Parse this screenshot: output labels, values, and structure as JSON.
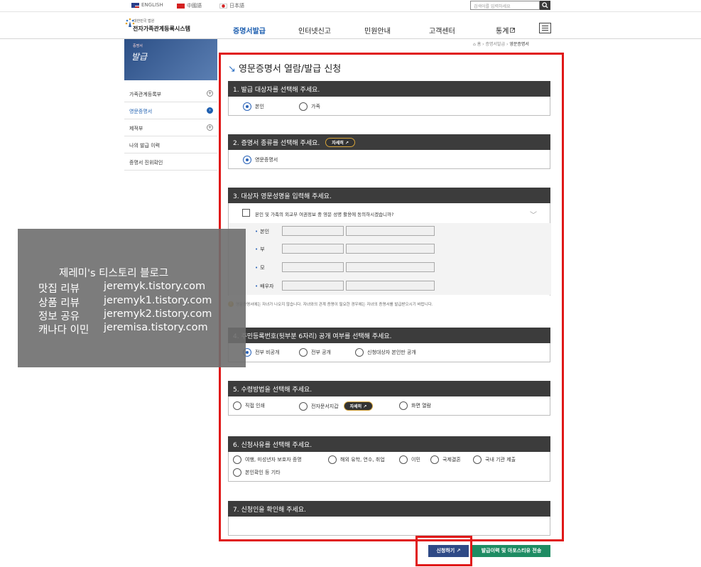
{
  "topbar": {
    "lang_english": "ENGLISH",
    "lang_chinese": "中國語",
    "lang_japanese": "日本語",
    "search_placeholder": "검색어를 입력하세요",
    "search_icon_name": "search-icon"
  },
  "header": {
    "logo_sub": "대한민국 법원",
    "logo_main": "전자가족관계등록시스템",
    "nav": [
      "증명서발급",
      "인터넷신고",
      "민원안내",
      "고객센터",
      "통계"
    ],
    "nav_active_index": 0,
    "nav_stats_icon": "external-link-icon",
    "menu_icon_name": "hamburger-icon"
  },
  "sidebar": {
    "banner_sub": "증명서",
    "banner_title": "발급",
    "items": [
      {
        "label": "가족관계등록부",
        "icon": "plus-icon",
        "active": false
      },
      {
        "label": "영문증명서",
        "icon": "chevron-right-icon",
        "active": true
      },
      {
        "label": "제적부",
        "icon": "plus-icon",
        "active": false
      },
      {
        "label": "나의 발급 이력",
        "icon": "",
        "active": false
      },
      {
        "label": "증명서 진위확인",
        "icon": "",
        "active": false
      }
    ]
  },
  "breadcrumb": {
    "home": "홈",
    "level1": "증명서발급",
    "level2": "영문증명서"
  },
  "page_title": "영문증명서 열람/발급 신청",
  "sections": {
    "s1": {
      "title": "1. 발급 대상자를 선택해 주세요.",
      "options": [
        "본인",
        "가족"
      ],
      "selected": 0
    },
    "s2": {
      "title": "2. 증명서 종류를 선택해 주세요.",
      "detail_label": "자세히",
      "options": [
        "영문증명서"
      ],
      "selected": 0
    },
    "s3": {
      "title": "3. 대상자 영문성명을 입력해 주세요.",
      "consent_text": "본인 및 가족의 외교부 여권정보 중 영문 성명 활용에 동의하시겠습니까?",
      "rows": [
        "본인",
        "부",
        "모",
        "배우자"
      ],
      "note": "영문증명서에는 자녀가 나오지 않습니다. 자녀와의 관계 증명이 필요한 경우에는 자녀의 증명서를 발급받으시기 바랍니다."
    },
    "s4": {
      "title": "4. 주민등록번호(뒷부분 6자리) 공개 여부를 선택해 주세요.",
      "options": [
        "전부 비공개",
        "전부 공개",
        "신청대상자 본인만 공개"
      ],
      "selected": 0
    },
    "s5": {
      "title": "5. 수령방법을 선택해 주세요.",
      "options": [
        "직접 인쇄",
        "전자문서지갑",
        "화면 열람"
      ],
      "detail_label": "자세히"
    },
    "s6": {
      "title": "6. 신청사유를 선택해 주세요.",
      "options": [
        "여행, 미성년자 보호자 증명",
        "해외 유학, 연수, 취업",
        "이민",
        "국제결혼",
        "국내 기관 제출",
        "본인확인 등 기타"
      ]
    },
    "s7": {
      "title": "7. 신청인을 확인해 주세요."
    }
  },
  "buttons": {
    "apply": "신청하기",
    "history": "발급이력 및 아포스티유 전송"
  },
  "watermark": {
    "title": "제레미's 티스토리 블로그",
    "rows": [
      {
        "label": "맛집 리뷰",
        "url": "jeremyk.tistory.com"
      },
      {
        "label": "상품 리뷰",
        "url": "jeremyk1.tistory.com"
      },
      {
        "label": "정보 공유",
        "url": "jeremyk2.tistory.com"
      },
      {
        "label": "캐나다 이민",
        "url": "jeremisa.tistory.com"
      }
    ]
  },
  "colors": {
    "accent_blue": "#1e5fb0",
    "header_dark": "#3c3c3c",
    "highlight_red": "#e01818",
    "apply_button": "#2f4a86",
    "history_button": "#1e8c63"
  }
}
